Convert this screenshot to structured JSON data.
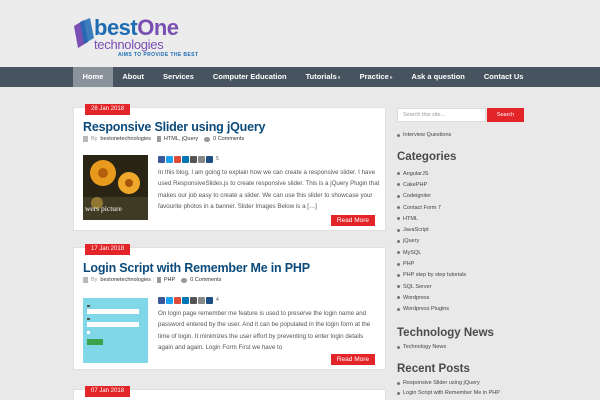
{
  "brand": {
    "name_part1": "best",
    "name_part2": "One",
    "name_line2": "technologies",
    "tagline": "AIMS TO PROVIDE THE BEST",
    "colors": {
      "blue": "#1d6bb3",
      "purple": "#7a4fb2"
    }
  },
  "nav": {
    "items": [
      {
        "label": "Home",
        "active": true
      },
      {
        "label": "About"
      },
      {
        "label": "Services"
      },
      {
        "label": "Computer Education"
      },
      {
        "label": "Tutorials",
        "has_dropdown": true
      },
      {
        "label": "Practice",
        "has_dropdown": true
      },
      {
        "label": "Ask a question"
      },
      {
        "label": "Contact Us"
      }
    ],
    "dropdown_icon": "»"
  },
  "posts": [
    {
      "date": "28 Jan 2018",
      "title": "Responsive Slider using jQuery",
      "author_prefix": "By",
      "author": "bestonetechnologies",
      "categories": "HTML, jQuery",
      "comments": "0 Comments",
      "share_count": "5",
      "thumb_caption": "wers picture",
      "excerpt": "In this blog, I am going to explain how we can create a responsive slider. I have used ResponsiveSlides.js to create responsive slider. This is a jQuery Plugin that makes our job easy to create a slider. We can use this slider to showcase your favourite photos in a banner. Slider Images Below is a […]",
      "read_more": "Read More"
    },
    {
      "date": "17 Jan 2018",
      "title": "Login Script with Remember Me in PHP",
      "author_prefix": "By",
      "author": "bestonetechnologies",
      "categories": "PHP",
      "comments": "0 Comments",
      "share_count": "4",
      "excerpt": "On login page remember me feature is used to preserve the login name and password entered by the user. And it can be populated in the login form at the time of login. It minimizes the user effort by preventing to enter login details again and again. Login Form First we have to",
      "read_more": "Read More"
    },
    {
      "date": "07 Jan 2018"
    }
  ],
  "sidebar": {
    "search_placeholder": "Search this site...",
    "search_button": "Search",
    "top_links": [
      "Interview Questions"
    ],
    "categories_title": "Categories",
    "categories": [
      "AngularJS",
      "CakePHP",
      "Codeigniter",
      "Contact Form 7",
      "HTML",
      "JavaScript",
      "jQuery",
      "MySQL",
      "PHP",
      "PHP step by step tutorials",
      "SQL Server",
      "Wordpress",
      "Wordpress Plugins"
    ],
    "tech_news_title": "Technology News",
    "tech_news": [
      "Technology News"
    ],
    "recent_posts_title": "Recent Posts",
    "recent_posts": [
      "Responsive Slider using jQuery",
      "Login Script with Remember Me in PHP"
    ]
  },
  "colors": {
    "accent": "#e32428",
    "nav_bg": "#475460",
    "nav_active": "#8a939b",
    "title": "#0b4a7a"
  }
}
